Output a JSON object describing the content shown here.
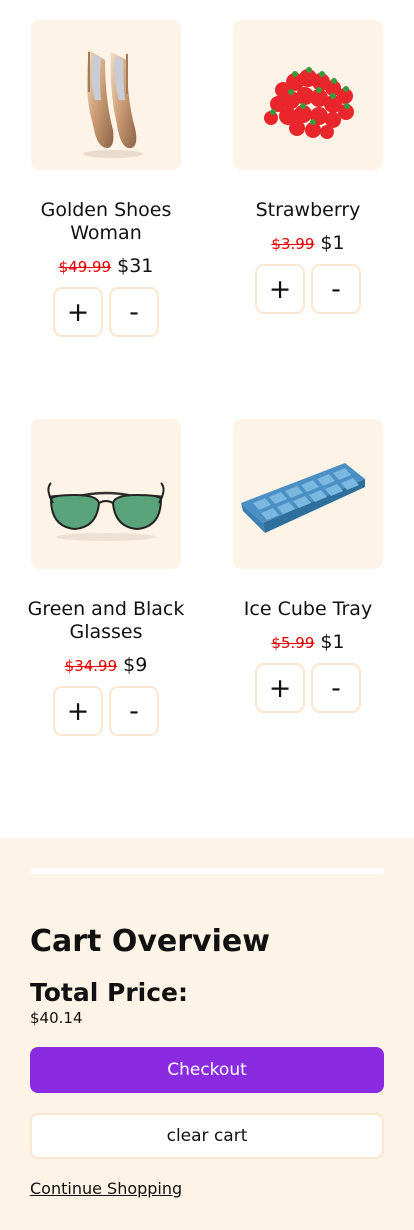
{
  "products": [
    {
      "name": "Golden Shoes Woman",
      "old_price": "$49.99",
      "new_price": "$31",
      "plus_label": "+",
      "minus_label": "-",
      "image": "golden-shoes"
    },
    {
      "name": "Strawberry",
      "old_price": "$3.99",
      "new_price": "$1",
      "plus_label": "+",
      "minus_label": "-",
      "image": "strawberries"
    },
    {
      "name": "Green and Black Glasses",
      "old_price": "$34.99",
      "new_price": "$9",
      "plus_label": "+",
      "minus_label": "-",
      "image": "sunglasses"
    },
    {
      "name": "Ice Cube Tray",
      "old_price": "$5.99",
      "new_price": "$1",
      "plus_label": "+",
      "minus_label": "-",
      "image": "ice-cube-tray"
    }
  ],
  "cart": {
    "title": "Cart Overview",
    "total_label": "Total Price:",
    "total_value": "$40.14",
    "checkout_label": "Checkout",
    "clear_label": "clear cart",
    "continue_label": "Continue Shopping"
  },
  "colors": {
    "accent": "#8a2be2",
    "panel_bg": "#fdf3e6",
    "old_price": "#e60000",
    "button_border": "#fbe7cf"
  }
}
